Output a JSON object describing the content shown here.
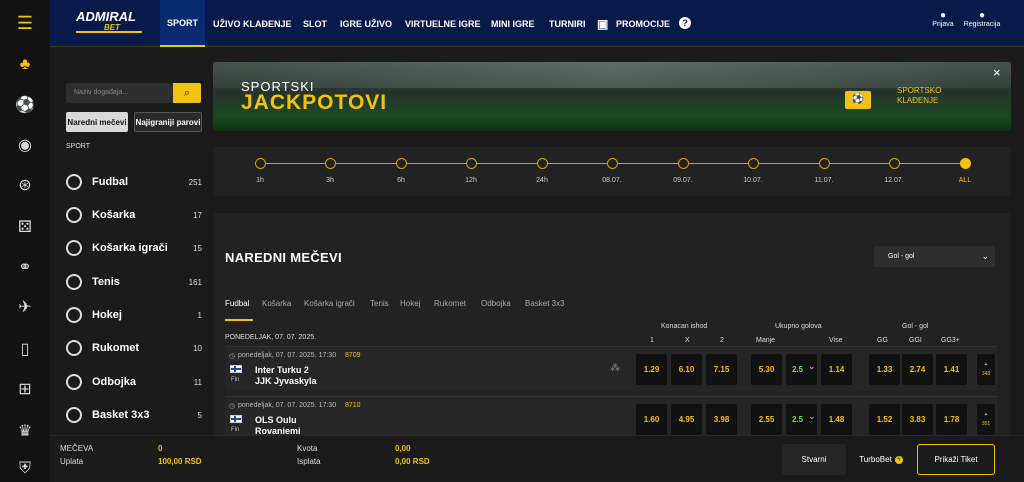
{
  "brand": {
    "name": "ADMIRAL",
    "sub": "BET"
  },
  "colors": {
    "accent": "#f2c210",
    "topbar": "#071a4a",
    "background": "#1b1b1b"
  },
  "rail_icons": [
    "menu-icon",
    "casino-icon",
    "live-sport-icon",
    "live-casino-icon",
    "roulette-icon",
    "dice-icon",
    "balls-icon",
    "plane-icon",
    "phone-icon",
    "gift-icon",
    "trophy-icon",
    "shield-icon"
  ],
  "nav": {
    "items": [
      "SPORT",
      "UŽIVO KLAĐENJE",
      "SLOT",
      "IGRE UŽIVO",
      "VIRTUELNE IGRE",
      "MINI IGRE",
      "TURNIRI",
      "PROMOCIJE"
    ],
    "login": "Prijava",
    "register": "Registracija"
  },
  "sidebar": {
    "search_placeholder": "Naziv događaja...",
    "tab_upcoming": "Naredni mečevi",
    "tab_popular": "Najigraniji parovi",
    "section": "SPORT",
    "sports": [
      {
        "name": "Fudbal",
        "count": "251"
      },
      {
        "name": "Košarka",
        "count": "17"
      },
      {
        "name": "Košarka igrači",
        "count": "15"
      },
      {
        "name": "Tenis",
        "count": "161"
      },
      {
        "name": "Hokej",
        "count": "1"
      },
      {
        "name": "Rukomet",
        "count": "10"
      },
      {
        "name": "Odbojka",
        "count": "11"
      },
      {
        "name": "Basket 3x3",
        "count": "5"
      }
    ]
  },
  "banner": {
    "kicker": "SPORTSKI",
    "title": "JACKPOTOVI",
    "badge_line1": "SPORTSKO",
    "badge_line2": "KLAĐENJE",
    "close": "×"
  },
  "timeline": {
    "labels": [
      "1h",
      "3h",
      "6h",
      "12h",
      "24h",
      "08.07.",
      "09.07.",
      "10.07.",
      "11.07.",
      "12.07.",
      "ALL"
    ],
    "selected": "ALL"
  },
  "main": {
    "title": "NAREDNI MEČEVI",
    "market_select": "Gol - gol",
    "sport_tabs": [
      "Fudbal",
      "Košarka",
      "Košarka igrači",
      "Tenis",
      "Hokej",
      "Rukomet",
      "Odbojka",
      "Basket 3x3"
    ],
    "date_heading": "PONEDELJAK, 07. 07. 2025.",
    "groups": {
      "g1": "Konacan ishod",
      "g2": "Ukupno golova",
      "g3": "Gol - gol"
    },
    "cols": {
      "c1": "1",
      "cx": "X",
      "c2": "2",
      "manje": "Manje",
      "vise": "Vise",
      "gg": "GG",
      "ggi": "GGI",
      "gg3": "GG3+"
    },
    "matches": [
      {
        "time": "ponedeljak, 07. 07. 2025. 17:30",
        "code": "8709",
        "country": "Fin",
        "home": "Inter Turku 2",
        "away": "JJK Jyvaskyla",
        "odds": [
          "1.29",
          "6.10",
          "7.15",
          "5.30",
          "2.5",
          "1.14",
          "1.33",
          "2.74",
          "1.41"
        ],
        "more": "348"
      },
      {
        "time": "ponedeljak, 07. 07. 2025. 17:30",
        "code": "8710",
        "country": "Fin",
        "home": "OLS Oulu",
        "away": "Rovaniemi",
        "odds": [
          "1.60",
          "4.95",
          "3.98",
          "2.55",
          "2.5",
          "1.48",
          "1.52",
          "3.83",
          "1.78"
        ],
        "more": "351"
      }
    ]
  },
  "footer": {
    "matches_label": "MEČEVA",
    "matches_value": "0",
    "stake_label": "Uplata",
    "stake_value": "100,00 RSD",
    "odds_label": "Kvota",
    "odds_value": "0,00",
    "payout_label": "Isplata",
    "payout_value": "0,00 RSD",
    "btn_stvarni": "Stvarni",
    "btn_turbo": "TurboBet",
    "btn_ticket": "Prikaži Tiket"
  }
}
